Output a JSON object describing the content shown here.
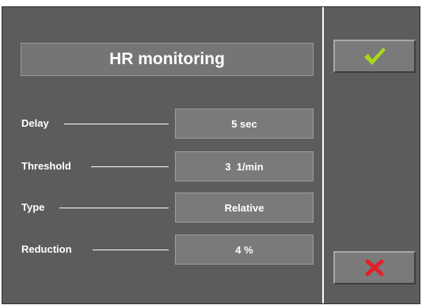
{
  "dialog": {
    "title": "HR monitoring"
  },
  "settings": [
    {
      "label": "Delay",
      "value": "5 sec"
    },
    {
      "label": "Threshold",
      "value": "3  1/min"
    },
    {
      "label": "Type",
      "value": "Relative"
    },
    {
      "label": "Reduction",
      "value": "4 %"
    }
  ],
  "buttons": {
    "confirm_icon": "checkmark-icon",
    "cancel_icon": "cross-icon"
  },
  "colors": {
    "background": "#5c5c5c",
    "confirm": "#a6d81c",
    "cancel": "#e0202a"
  }
}
